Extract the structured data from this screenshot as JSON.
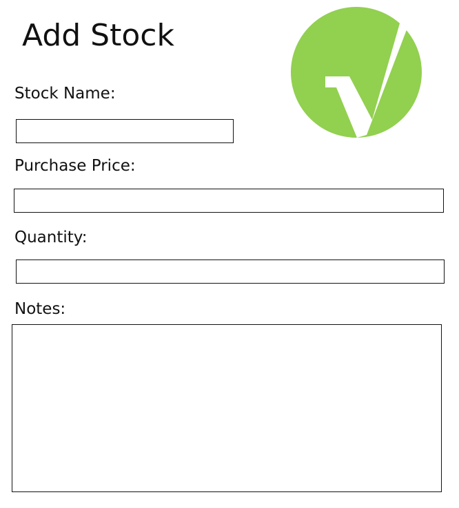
{
  "page": {
    "title": "Add Stock"
  },
  "logo": {
    "icon": "checkmark-logo-icon",
    "accent_color": "#92d050"
  },
  "form": {
    "stock_name": {
      "label": "Stock Name:",
      "value": "",
      "placeholder": ""
    },
    "purchase_price": {
      "label": "Purchase Price:",
      "value": "",
      "placeholder": ""
    },
    "quantity": {
      "label": "Quantity:",
      "value": "",
      "placeholder": ""
    },
    "notes": {
      "label": "Notes:",
      "value": "",
      "placeholder": ""
    }
  }
}
